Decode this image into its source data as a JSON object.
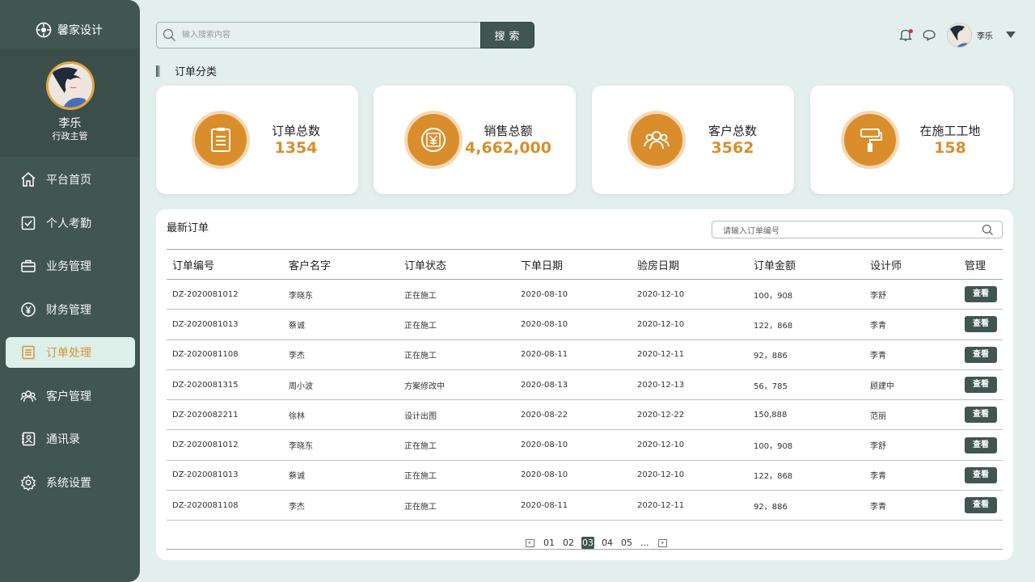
{
  "brand": {
    "name": "馨家设计"
  },
  "profile": {
    "name": "李乐",
    "role": "行政主管"
  },
  "nav": [
    {
      "label": "平台首页",
      "icon": "home-icon"
    },
    {
      "label": "个人考勤",
      "icon": "checkbox-icon"
    },
    {
      "label": "业务管理",
      "icon": "briefcase-icon"
    },
    {
      "label": "财务管理",
      "icon": "yuan-coin-icon"
    },
    {
      "label": "订单处理",
      "icon": "order-list-icon",
      "active": true
    },
    {
      "label": "客户管理",
      "icon": "users-icon"
    },
    {
      "label": "通讯录",
      "icon": "contacts-icon"
    },
    {
      "label": "系统设置",
      "icon": "gear-icon"
    }
  ],
  "search": {
    "placeholder": "输入搜索内容",
    "button": "搜索"
  },
  "topbar": {
    "user": "李乐"
  },
  "section": {
    "title": "订单分类"
  },
  "stats": [
    {
      "label": "订单总数",
      "value": "1354",
      "icon": "clipboard-icon"
    },
    {
      "label": "销售总额",
      "value": "4,662,000",
      "icon": "yuan-coin-icon"
    },
    {
      "label": "客户总数",
      "value": "3562",
      "icon": "users-icon"
    },
    {
      "label": "在施工工地",
      "value": "158",
      "icon": "paint-roller-icon"
    }
  ],
  "orders": {
    "title": "最新订单",
    "search_placeholder": "请输入订单编号",
    "columns": [
      "订单编号",
      "客户名字",
      "订单状态",
      "下单日期",
      "验房日期",
      "订单金额",
      "设计师",
      "管理"
    ],
    "rows": [
      [
        "DZ-2020081012",
        "李晓东",
        "正在施工",
        "2020-08-10",
        "2020-12-10",
        "100，908",
        "李舒",
        "查看"
      ],
      [
        "DZ-2020081013",
        "蔡诚",
        "正在施工",
        "2020-08-10",
        "2020-12-10",
        "122，868",
        "李青",
        "查看"
      ],
      [
        "DZ-2020081108",
        "李杰",
        "正在施工",
        "2020-08-11",
        "2020-12-11",
        "92，886",
        "李青",
        "查看"
      ],
      [
        "DZ-2020081315",
        "周小波",
        "方案修改中",
        "2020-08-13",
        "2020-12-13",
        "56，785",
        "顾建中",
        "查看"
      ],
      [
        "DZ-2020082211",
        "徐林",
        "设计出图",
        "2020-08-22",
        "2020-12-22",
        "150,888",
        "范丽",
        "查看"
      ],
      [
        "DZ-2020081012",
        "李晓东",
        "正在施工",
        "2020-08-10",
        "2020-12-10",
        "100，908",
        "李舒",
        "查看"
      ],
      [
        "DZ-2020081013",
        "蔡诚",
        "正在施工",
        "2020-08-10",
        "2020-12-10",
        "122，868",
        "李青",
        "查看"
      ],
      [
        "DZ-2020081108",
        "李杰",
        "正在施工",
        "2020-08-11",
        "2020-12-11",
        "92，886",
        "李青",
        "查看"
      ]
    ]
  },
  "pagination": {
    "pages": [
      "01",
      "02",
      "03",
      "04",
      "05",
      "..."
    ],
    "current": "03"
  },
  "colors": {
    "sidebar": "#415651",
    "accent": "#d98e2b",
    "background": "#e2efed"
  }
}
